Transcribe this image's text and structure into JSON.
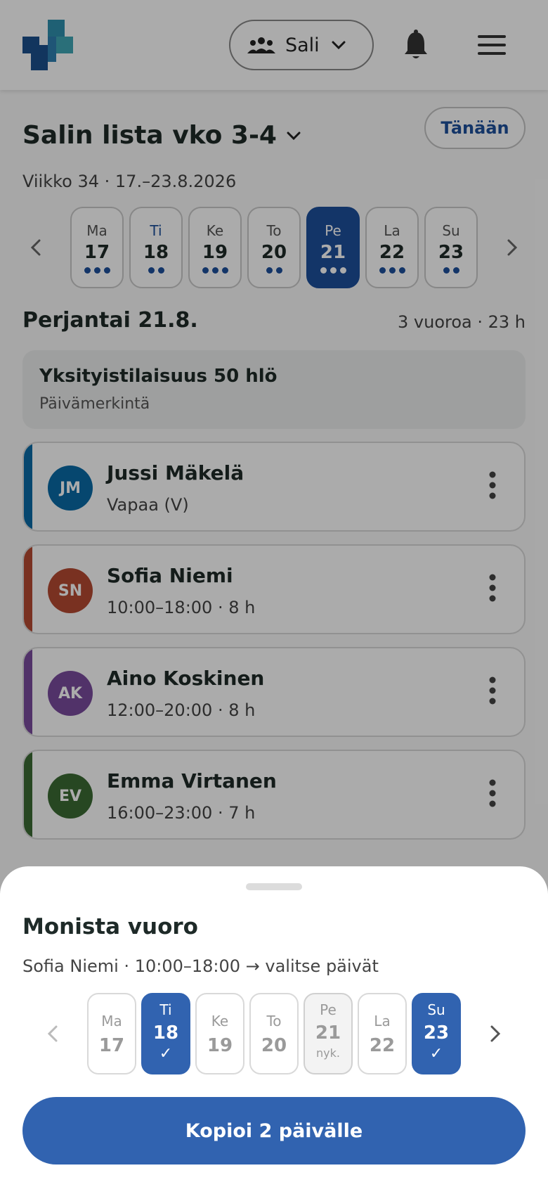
{
  "header": {
    "location_label": "Sali",
    "icons": {
      "logo": "app-logo",
      "people": "people-icon",
      "bell": "bell-icon",
      "menu": "hamburger-menu-icon"
    },
    "brand_colors": [
      "#1b4f8c",
      "#3fa6b5"
    ]
  },
  "page": {
    "title": "Salin lista vko 3-4",
    "today_label": "Tänään",
    "week_subtitle": "Viikko 34 · 17.–23.8.2026"
  },
  "days": [
    {
      "name": "Ma",
      "date": "17",
      "dots": 3
    },
    {
      "name": "Ti",
      "date": "18",
      "dots": 2
    },
    {
      "name": "Ke",
      "date": "19",
      "dots": 3
    },
    {
      "name": "To",
      "date": "20",
      "dots": 2
    },
    {
      "name": "Pe",
      "date": "21",
      "dots": 3,
      "active": true
    },
    {
      "name": "La",
      "date": "22",
      "dots": 3
    },
    {
      "name": "Su",
      "date": "23",
      "dots": 2
    }
  ],
  "day_view": {
    "title": "Perjantai 21.8.",
    "meta": "3 vuoroa · 23 h",
    "note": {
      "title": "Yksityistilaisuus 50 hlö",
      "subtitle": "Päivämerkintä"
    },
    "shifts": [
      {
        "initials": "JM",
        "name": "Jussi Mäkelä",
        "detail": "Vapaa (V)",
        "color": "#0a6ba6"
      },
      {
        "initials": "SN",
        "name": "Sofia Niemi",
        "detail": "10:00–18:00 · 8 h",
        "color": "#b54a32"
      },
      {
        "initials": "AK",
        "name": "Aino Koskinen",
        "detail": "12:00–20:00 · 8 h",
        "color": "#7a4b9d"
      },
      {
        "initials": "EV",
        "name": "Emma Virtanen",
        "detail": "16:00–23:00 · 7 h",
        "color": "#3b6b34"
      }
    ]
  },
  "sheet": {
    "title": "Monista vuoro",
    "subtitle": "Sofia Niemi · 10:00–18:00 → valitse päivät",
    "days": [
      {
        "name": "Ma",
        "date": "17",
        "state": "normal"
      },
      {
        "name": "Ti",
        "date": "18",
        "state": "selected",
        "mark": "✓"
      },
      {
        "name": "Ke",
        "date": "19",
        "state": "normal"
      },
      {
        "name": "To",
        "date": "20",
        "state": "normal"
      },
      {
        "name": "Pe",
        "date": "21",
        "state": "current",
        "mark": "nyk."
      },
      {
        "name": "La",
        "date": "22",
        "state": "normal"
      },
      {
        "name": "Su",
        "date": "23",
        "state": "selected",
        "mark": "✓"
      }
    ],
    "button_label": "Kopioi 2 päivälle",
    "accent": "#3163b0"
  }
}
